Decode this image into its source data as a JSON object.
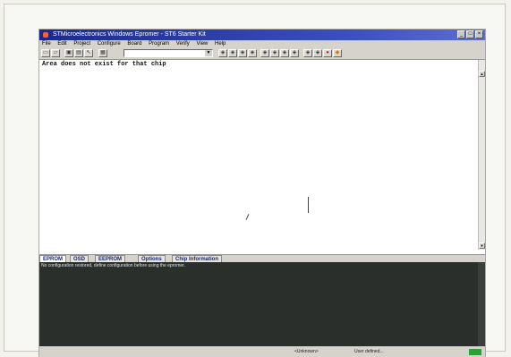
{
  "window": {
    "title": "STMicroelectronics Windows Epromer - ST6 Starter Kit",
    "controls": [
      "_",
      "□",
      "×"
    ]
  },
  "menu": {
    "items": [
      "File",
      "Edit",
      "Project",
      "Configure",
      "Board",
      "Program",
      "Verify",
      "View",
      "Help"
    ]
  },
  "toolbar": {
    "combo_value": "",
    "icons": [
      "new-icon",
      "open-icon",
      "save-icon",
      "print-icon",
      "pointer-icon",
      "chip-icon",
      "program-icon"
    ]
  },
  "editor": {
    "message": "Area does not exist for that chip"
  },
  "tabs": {
    "items": [
      "EPROM",
      "OSD",
      "EEPROM",
      "Options",
      "Chip Information"
    ]
  },
  "output": {
    "message": "No configuration restored, define configuration before using the epromer."
  },
  "status": {
    "device": "<Unknown>",
    "mode": "User defined...",
    "indicator_color": "#2e9e3a"
  },
  "colors": {
    "titlebar": "#1c2a8a",
    "output_bg": "#2a2f2c",
    "tab_text": "#1a2a6e"
  }
}
